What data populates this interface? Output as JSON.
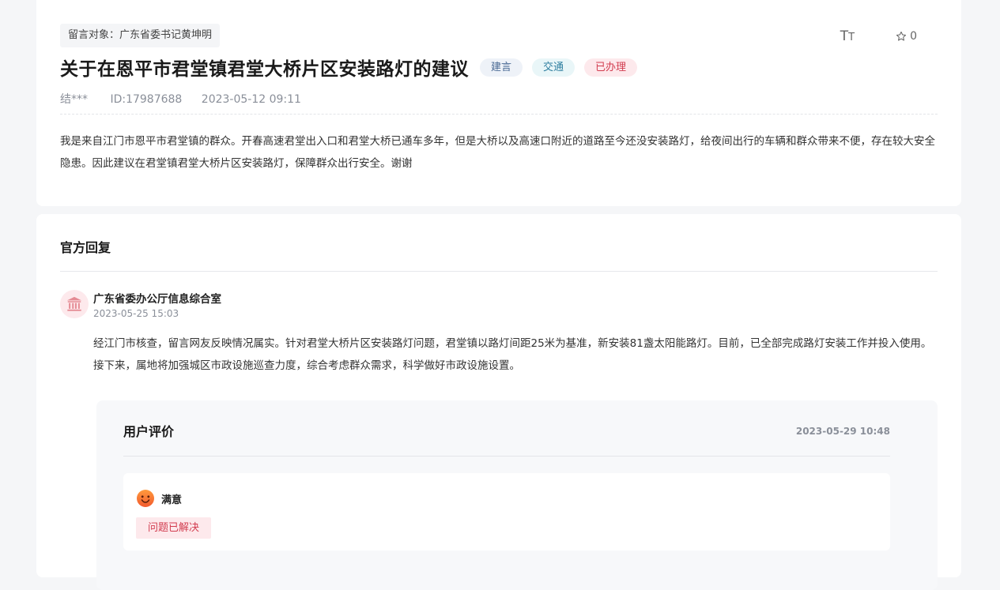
{
  "message": {
    "target_label": "留言对象：广东省委书记黄坤明",
    "title": "关于在恩平市君堂镇君堂大桥片区安装路灯的建议",
    "tags": {
      "type": "建言",
      "category": "交通",
      "status": "已办理"
    },
    "author": "结***",
    "id_label": "ID:17987688",
    "date": "2023-05-12 09:11",
    "body": "我是来自江门市恩平市君堂镇的群众。开春高速君堂出入口和君堂大桥已通车多年，但是大桥以及高速口附近的道路至今还没安装路灯，给夜间出行的车辆和群众带来不便，存在较大安全隐患。因此建议在君堂镇君堂大桥片区安装路灯，保障群众出行安全。谢谢",
    "favorite_count": "0"
  },
  "tools": {
    "font_size_icon": "font-size-icon",
    "star_icon": "star-icon"
  },
  "reply": {
    "section_title": "官方回复",
    "org_icon": "government-building-icon",
    "org_name": "广东省委办公厅信息综合室",
    "time": "2023-05-25 15:03",
    "text": "经江门市核查，留言网友反映情况属实。针对君堂大桥片区安装路灯问题，君堂镇以路灯间距25米为基准，新安装81盏太阳能路灯。目前，已全部完成路灯安装工作并投入使用。接下来，属地将加强城区市政设施巡查力度，综合考虑群众需求，科学做好市政设施设置。"
  },
  "evaluation": {
    "title": "用户评价",
    "date": "2023-05-29 10:48",
    "rating_icon": "smile-face-icon",
    "rating_label": "满意",
    "resolved_tag": "问题已解决"
  },
  "colors": {
    "accent_red": "#d23c4f",
    "tag_blue": "#4a6a94",
    "tag_teal": "#2f7fa0"
  }
}
